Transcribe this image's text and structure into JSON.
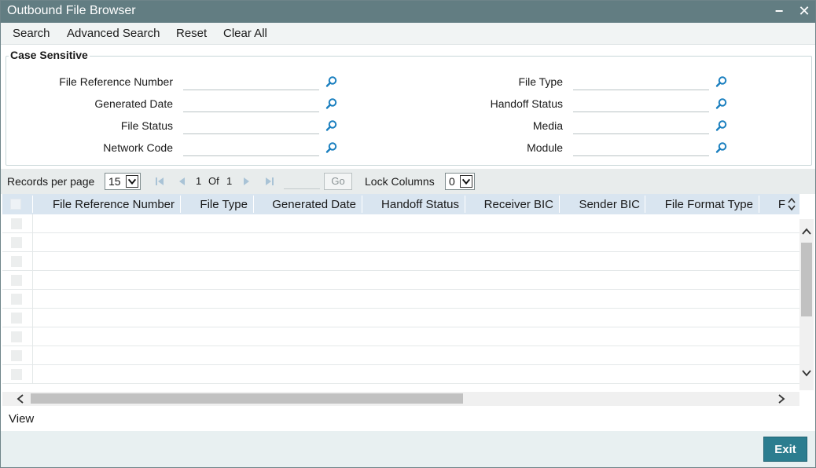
{
  "window": {
    "title": "Outbound File Browser",
    "minimize_glyph": "−",
    "close_glyph": "✕"
  },
  "menu": {
    "search": "Search",
    "advanced_search": "Advanced Search",
    "reset": "Reset",
    "clear_all": "Clear All"
  },
  "criteria": {
    "legend": "Case Sensitive",
    "left_fields": [
      {
        "label": "File Reference Number",
        "value": ""
      },
      {
        "label": "Generated Date",
        "value": ""
      },
      {
        "label": "File Status",
        "value": ""
      },
      {
        "label": "Network Code",
        "value": ""
      }
    ],
    "right_fields": [
      {
        "label": "File Type",
        "value": ""
      },
      {
        "label": "Handoff Status",
        "value": ""
      },
      {
        "label": "Media",
        "value": ""
      },
      {
        "label": "Module",
        "value": ""
      }
    ],
    "lookup_icon": "search-magnifier-icon"
  },
  "pager": {
    "records_label": "Records per page",
    "records_value": "15",
    "current_page": "1",
    "of_label": "Of",
    "total_pages": "1",
    "goto_value": "",
    "go_label": "Go",
    "lock_label": "Lock Columns",
    "lock_value": "0"
  },
  "grid": {
    "columns": [
      "File Reference Number",
      "File Type",
      "Generated Date",
      "Handoff Status",
      "Receiver BIC",
      "Sender BIC",
      "File Format Type",
      "F"
    ],
    "row_count": 9,
    "header_color": "#d9e5f0"
  },
  "footer": {
    "view_label": "View",
    "exit_label": "Exit",
    "exit_color": "#2b7d8f"
  },
  "colors": {
    "titlebar": "#627d82",
    "lookup_icon": "#1a7fbf"
  }
}
